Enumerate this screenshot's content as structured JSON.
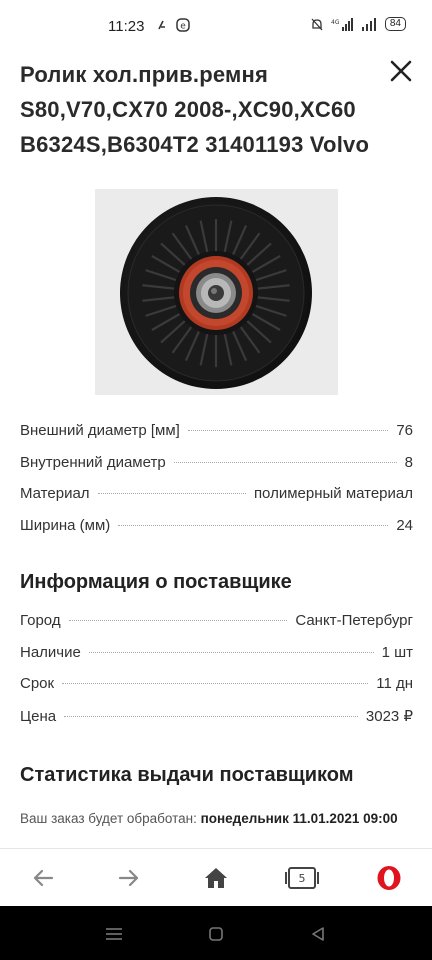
{
  "status": {
    "time": "11:23",
    "network": "4G",
    "battery": "84"
  },
  "product": {
    "title": "Ролик хол.прив.ремня S80,V70,CX70 2008-,XC90,XC60 B6324S,B6304T2 31401193 Volvo"
  },
  "specs": [
    {
      "label": "Внешний диаметр [мм]",
      "value": "76"
    },
    {
      "label": "Внутренний диаметр",
      "value": "8"
    },
    {
      "label": "Материал",
      "value": "полимерный материал"
    },
    {
      "label": "Ширина (мм)",
      "value": "24"
    }
  ],
  "supplier": {
    "heading": "Информация о поставщике",
    "rows": [
      {
        "label": "Город",
        "value": "Санкт-Петербург"
      },
      {
        "label": "Наличие",
        "value": "1 шт"
      },
      {
        "label": "Срок",
        "value": "11 дн"
      },
      {
        "label": "Цена",
        "value": "3023 ₽"
      }
    ]
  },
  "stats": {
    "heading": "Статистика выдачи поставщиком",
    "order_prefix": "Ваш заказ будет обработан: ",
    "order_date": "понедельник 11.01.2021 09:00"
  },
  "toolbar": {
    "tabs_count": "5",
    "icons": [
      "back-arrow-icon",
      "forward-arrow-icon",
      "home-icon",
      "tabs-icon",
      "opera-icon"
    ]
  },
  "colors": {
    "opera_red": "#e0141e",
    "text": "#222222",
    "nav_bg": "#000000"
  }
}
